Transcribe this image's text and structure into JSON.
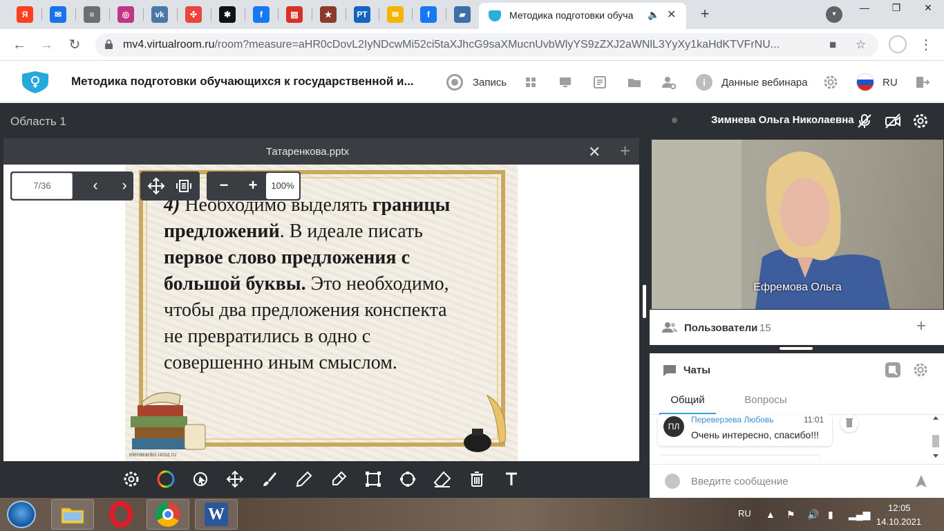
{
  "browser": {
    "tabs": [
      {
        "icon": "yandex-icon",
        "glyph": "Я",
        "color": "#fc3f1d"
      },
      {
        "icon": "mail-icon",
        "glyph": "✉",
        "color": "#1a73e8"
      },
      {
        "icon": "document-icon",
        "glyph": "≡",
        "color": "#6e6e6e"
      },
      {
        "icon": "instagram-icon",
        "glyph": "◎",
        "color": "#c13584"
      },
      {
        "icon": "vk-icon",
        "glyph": "vk",
        "color": "#4a76a8"
      },
      {
        "icon": "pinwheel-icon",
        "glyph": "✣",
        "color": "#e8453c"
      },
      {
        "icon": "dzen-icon",
        "glyph": "✱",
        "color": "#111111"
      },
      {
        "icon": "facebook-icon",
        "glyph": "f",
        "color": "#1877f2"
      },
      {
        "icon": "bookmark-icon",
        "glyph": "▤",
        "color": "#d93025"
      },
      {
        "icon": "star-icon",
        "glyph": "★",
        "color": "#8b3a2b"
      },
      {
        "icon": "rt-icon",
        "glyph": "РТ",
        "color": "#1565c0"
      },
      {
        "icon": "envelope-icon",
        "glyph": "✉",
        "color": "#f4b400"
      },
      {
        "icon": "facebook-icon",
        "glyph": "f",
        "color": "#1877f2"
      },
      {
        "icon": "chart-icon",
        "glyph": "▰",
        "color": "#3c6ea8"
      }
    ],
    "active_tab_title": "Методика подготовки обуча",
    "url_host": "mv4.virtualroom.ru",
    "url_path": "/room?measure=aHR0cDovL2IyNDcwMi52ci5taXJhcG9saXMucnUvbWlyYS9zZXJ2aWNlL3YyXy1kaHdKTVFrNU..."
  },
  "app": {
    "title": "Методика подготовки обучающихся к государственной и...",
    "record_label": "Запись",
    "webinar_data_label": "Данные вебинара",
    "language": "RU"
  },
  "stage": {
    "area_label": "Область 1",
    "doc_title": "Татаренкова.pptx",
    "page": "7/36",
    "zoom": "100%"
  },
  "slide": {
    "line1_prefix": "4)",
    "line1_text": " Необходимо выделять ",
    "line1_bold": "границы",
    "line2_bold": "предложений",
    "line2_text": ". В идеале писать",
    "line3_bold": "первое слово предложения с",
    "line4_bold": "большой буквы.",
    "line4_text": " Это необходимо,",
    "line5": "чтобы два предложения  конспекта",
    "line6": "не превратились в одно с",
    "line7": "совершенно иным смыслом.",
    "credit": "elenaranko.ucoz.ru"
  },
  "speaker": {
    "name": "Зимнева Ольга Николаевна",
    "video_label": "Ефремова Ольга"
  },
  "users": {
    "label": "Пользователи",
    "count": "15"
  },
  "chat": {
    "title": "Чаты",
    "tabs": [
      "Общий",
      "Вопросы"
    ],
    "messages": [
      {
        "initials": "ПЛ",
        "author": "Переверзева Любовь",
        "time": "11:01",
        "text": "Очень интересно, спасибо!!!"
      }
    ],
    "placeholder": "Введите сообщение"
  },
  "taskbar": {
    "lang": "RU",
    "time": "12:05",
    "date": "14.10.2021"
  }
}
